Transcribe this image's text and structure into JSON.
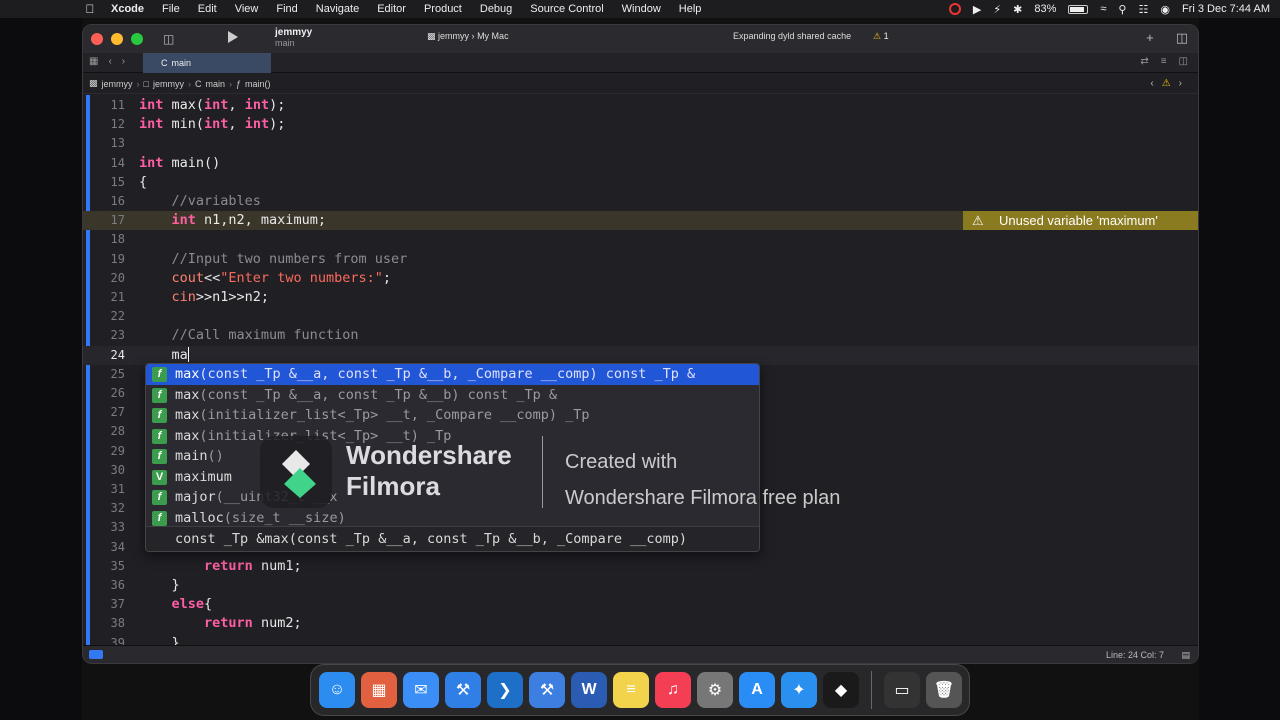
{
  "menubar": {
    "app": "Xcode",
    "items": [
      "File",
      "Edit",
      "View",
      "Find",
      "Navigate",
      "Editor",
      "Product",
      "Debug",
      "Source Control",
      "Window",
      "Help"
    ],
    "battery": "83%",
    "battery_fill": 0.83,
    "clock": "Fri 3 Dec  7:44 AM"
  },
  "toolbar": {
    "scheme_name": "jemmyy",
    "scheme_branch": "main",
    "destination_project": "jemmyy",
    "destination_device": "My Mac",
    "activity_status": "Expanding dyld shared cache",
    "warning_count": "1"
  },
  "tabs": [
    {
      "label": "main"
    }
  ],
  "jumpbar": {
    "crumbs": [
      "jemmyy",
      "jemmyy",
      "main",
      "main()"
    ]
  },
  "editor": {
    "lines": [
      {
        "num": "11",
        "text": "int max(int, int);"
      },
      {
        "num": "12",
        "text": "int min(int, int);"
      },
      {
        "num": "13",
        "text": ""
      },
      {
        "num": "14",
        "text": "int main()"
      },
      {
        "num": "15",
        "text": "{"
      },
      {
        "num": "16",
        "text": "    //variables"
      },
      {
        "num": "17",
        "text": "    int n1,n2, maximum;"
      },
      {
        "num": "18",
        "text": ""
      },
      {
        "num": "19",
        "text": "    //Input two numbers from user"
      },
      {
        "num": "20",
        "text": "    cout<<\"Enter two numbers:\";"
      },
      {
        "num": "21",
        "text": "    cin>>n1>>n2;"
      },
      {
        "num": "22",
        "text": ""
      },
      {
        "num": "23",
        "text": "    //Call maximum function"
      },
      {
        "num": "24",
        "text": "    ma"
      },
      {
        "num": "25",
        "text": ""
      },
      {
        "num": "26",
        "text": ""
      },
      {
        "num": "27",
        "text": ""
      },
      {
        "num": "28",
        "text": ""
      },
      {
        "num": "29",
        "text": ""
      },
      {
        "num": "30",
        "text": ""
      },
      {
        "num": "31",
        "text": ""
      },
      {
        "num": "32",
        "text": ""
      },
      {
        "num": "33",
        "text": ""
      },
      {
        "num": "34",
        "text": ""
      },
      {
        "num": "35",
        "text": "        return num1;"
      },
      {
        "num": "36",
        "text": "    }"
      },
      {
        "num": "37",
        "text": "    else{"
      },
      {
        "num": "38",
        "text": "        return num2;"
      },
      {
        "num": "39",
        "text": "    }"
      }
    ],
    "issue_message": "Unused variable 'maximum'"
  },
  "completion": {
    "items": [
      {
        "kind": "f",
        "label": "max",
        "detail": "(const _Tp &__a, const _Tp &__b, _Compare __comp) const _Tp &"
      },
      {
        "kind": "f",
        "label": "max",
        "detail": "(const _Tp &__a, const _Tp &__b) const _Tp &"
      },
      {
        "kind": "f",
        "label": "max",
        "detail": "(initializer_list<_Tp> __t, _Compare __comp) _Tp"
      },
      {
        "kind": "f",
        "label": "max",
        "detail": "(initializer_list<_Tp> __t) _Tp"
      },
      {
        "kind": "f",
        "label": "main",
        "detail": "()"
      },
      {
        "kind": "V",
        "label": "maximum",
        "detail": ""
      },
      {
        "kind": "f",
        "label": "major",
        "detail": "(__uint32_t __x"
      },
      {
        "kind": "f",
        "label": "malloc",
        "detail": "(size_t __size)"
      }
    ],
    "signature": "const _Tp &max(const _Tp &__a, const _Tp &__b, _Compare __comp)"
  },
  "watermark": {
    "brand_line1": "Wondershare",
    "brand_line2": "Filmora",
    "created_line1": "Created with",
    "created_line2": "Wondershare Filmora free plan"
  },
  "statusbar": {
    "position": "Line: 24  Col: 7"
  },
  "colors": {
    "accent": "#3478f6",
    "warning": "#f5c518",
    "selection": "#2156d6"
  },
  "dock": {
    "apps": [
      {
        "name": "finder",
        "glyph": "☺",
        "color": "#2d8cf0"
      },
      {
        "name": "launchpad",
        "glyph": "▦",
        "color": "#e06040"
      },
      {
        "name": "mail",
        "glyph": "✉",
        "color": "#3a8ef5"
      },
      {
        "name": "xcode",
        "glyph": "⚒",
        "color": "#2f7fe6"
      },
      {
        "name": "vscode",
        "glyph": "❯",
        "color": "#1e6fc7"
      },
      {
        "name": "xcode-beta",
        "glyph": "⚒",
        "color": "#3d7fe0"
      },
      {
        "name": "word",
        "glyph": "W",
        "color": "#2b5cb3"
      },
      {
        "name": "notes",
        "glyph": "≡",
        "color": "#f3d24c"
      },
      {
        "name": "music",
        "glyph": "♫",
        "color": "#f33e54"
      },
      {
        "name": "system-preferences",
        "glyph": "⚙",
        "color": "#777"
      },
      {
        "name": "app-store",
        "glyph": "A",
        "color": "#2a8cf5"
      },
      {
        "name": "safari",
        "glyph": "✦",
        "color": "#2a90f0"
      },
      {
        "name": "filmora",
        "glyph": "◆",
        "color": "#1a1a1a"
      },
      {
        "name": "screen-recorder",
        "glyph": "▭",
        "color": "#333"
      },
      {
        "name": "trash",
        "glyph": "🗑",
        "color": "#555"
      }
    ]
  }
}
